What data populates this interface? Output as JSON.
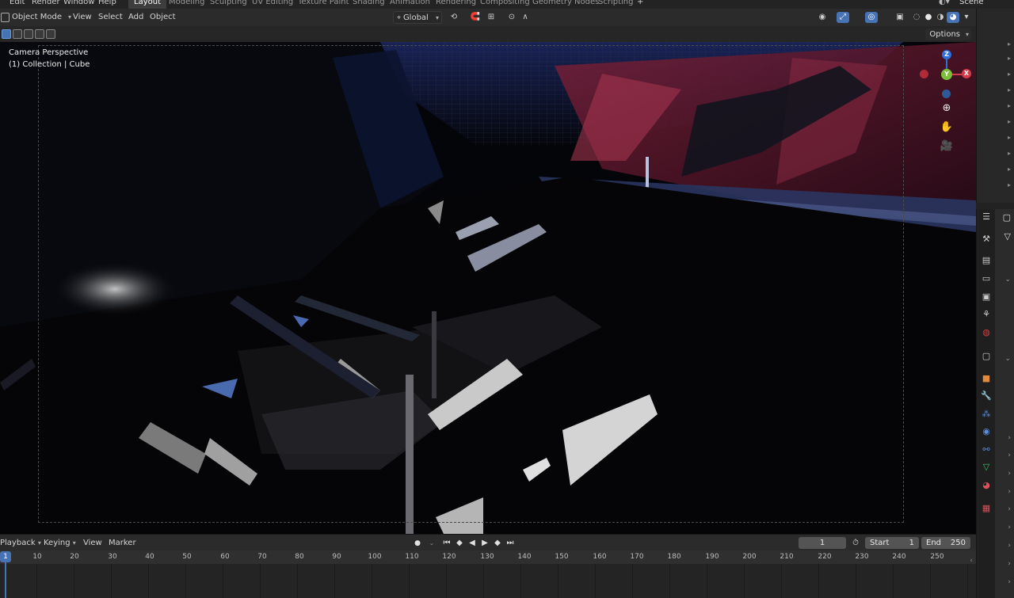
{
  "menu": {
    "items": [
      "Edit",
      "Render",
      "Window",
      "Help"
    ]
  },
  "workspaces": {
    "tabs": [
      "Layout",
      "Modeling",
      "Sculpting",
      "UV Editing",
      "Texture Paint",
      "Shading",
      "Animation",
      "Rendering",
      "Compositing",
      "Geometry Nodes",
      "Scripting"
    ],
    "active": "Layout",
    "add_icon": "plus-icon"
  },
  "scene": {
    "label": "Scene"
  },
  "viewport_header": {
    "mode": "Object Mode",
    "menus": [
      "View",
      "Select",
      "Add",
      "Object"
    ],
    "transform_orientation": "Global",
    "options_label": "Options"
  },
  "viewport": {
    "perspective_label": "Camera Perspective",
    "collection_label": "(1) Collection | Cube",
    "gizmo_axes": {
      "z": "Z",
      "x": "X",
      "y": "Y"
    },
    "accent": "#4772b3"
  },
  "timeline": {
    "menus": [
      "Playback",
      "Keying",
      "View",
      "Marker"
    ],
    "current_frame": "1",
    "start_label": "Start",
    "start_value": "1",
    "end_label": "End",
    "end_value": "250",
    "ticks": [
      "10",
      "20",
      "30",
      "40",
      "50",
      "60",
      "70",
      "80",
      "90",
      "100",
      "110",
      "120",
      "130",
      "140",
      "150",
      "160",
      "170",
      "180",
      "190",
      "200",
      "210",
      "220",
      "230",
      "240",
      "250"
    ],
    "current_marker": "1"
  },
  "properties": {
    "tab_icons": [
      "tool-icon",
      "render-icon",
      "output-icon",
      "view-layer-icon",
      "scene-icon",
      "world-icon",
      "collection-icon",
      "object-icon",
      "modifier-icon",
      "particles-icon",
      "physics-icon",
      "constraints-icon",
      "data-icon",
      "material-icon",
      "texture-icon"
    ]
  }
}
